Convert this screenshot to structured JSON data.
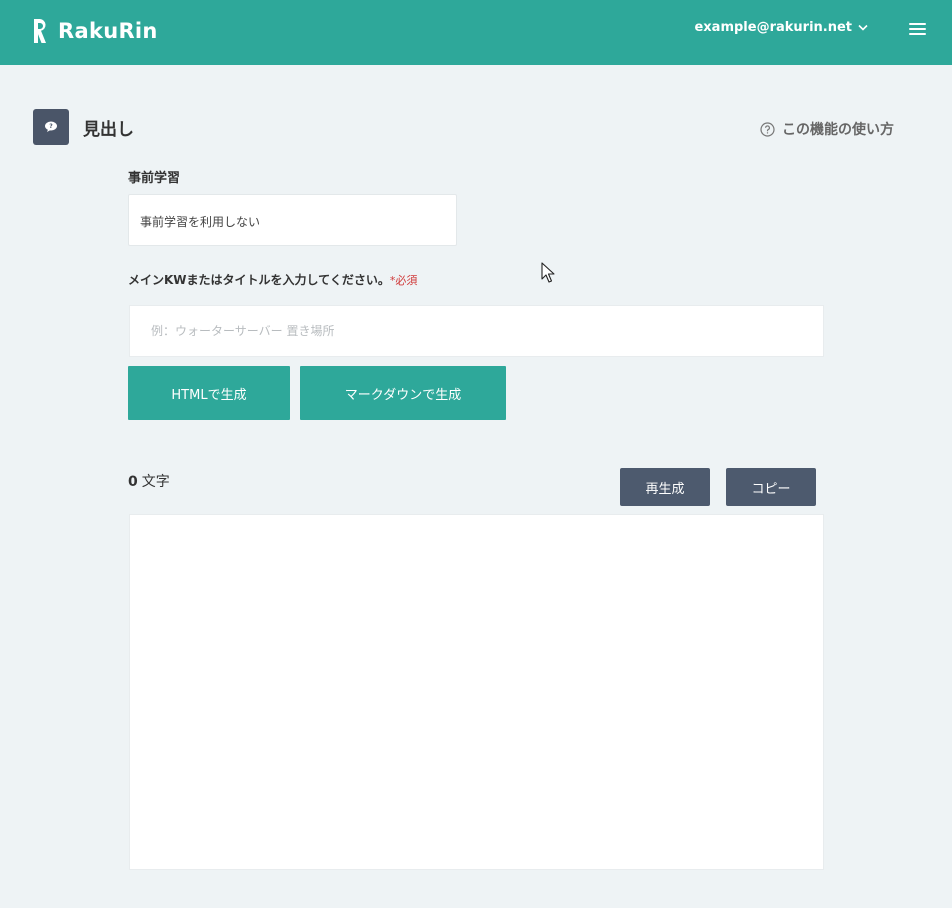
{
  "header": {
    "logo_text": "RakuRin",
    "user_email": "example@rakurin.net"
  },
  "page": {
    "title": "見出し",
    "help_link": "この機能の使い方"
  },
  "form": {
    "pre_learning_label": "事前学習",
    "pre_learning_value": "事前学習を利用しない",
    "keyword_label": "メインKWまたはタイトルを入力してください。",
    "required_mark": "*必須",
    "keyword_placeholder": "例：ウォーターサーバー 置き場所",
    "keyword_value": ""
  },
  "actions": {
    "html_button": "HTMLで生成",
    "markdown_button": "マークダウンで生成"
  },
  "output": {
    "char_count": "0",
    "char_unit": "文字",
    "regenerate_button": "再生成",
    "copy_button": "コピー"
  },
  "colors": {
    "header_bg": "#2ea89a",
    "primary_button": "#2ea89a",
    "secondary_button": "#4d5a6e",
    "required": "#d03a3a"
  },
  "icons": {
    "logo": "rakurin-logo-icon",
    "user_dropdown": "chevron-down-icon",
    "menu": "hamburger-menu-icon",
    "page": "speech-bubble-icon",
    "help": "question-circle-icon"
  }
}
